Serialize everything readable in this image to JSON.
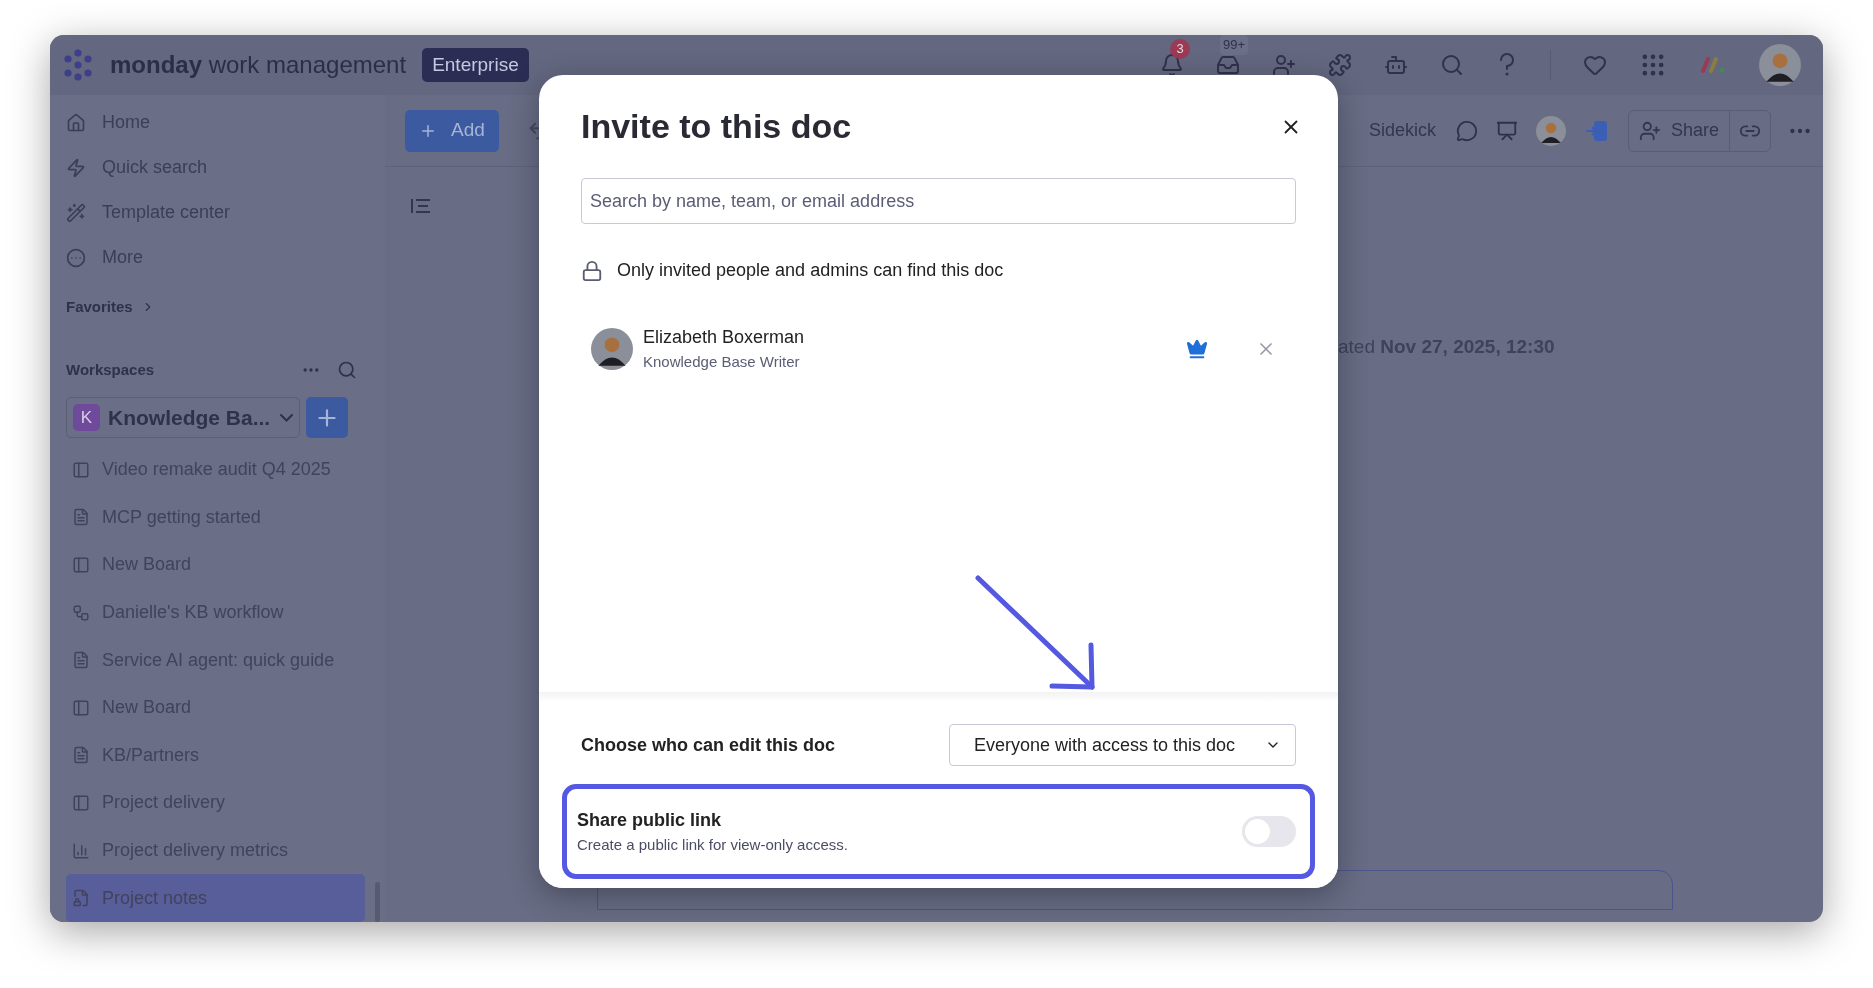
{
  "top_bar": {
    "brand_bold": "monday",
    "brand_rest": "work management",
    "plan_badge": "Enterprise",
    "notification_count": "3",
    "inbox_count": "99+"
  },
  "sidebar": {
    "nav": [
      {
        "label": "Home",
        "kind": "home"
      },
      {
        "label": "Quick search",
        "kind": "quick"
      },
      {
        "label": "Template center",
        "kind": "templates"
      },
      {
        "label": "More",
        "kind": "more"
      }
    ],
    "favorites": "Favorites",
    "workspaces": "Workspaces",
    "workspace": {
      "initial": "K",
      "name": "Knowledge Ba..."
    },
    "items": [
      {
        "label": "Video remake audit Q4 2025",
        "kind": "board",
        "selected": false
      },
      {
        "label": "MCP getting started",
        "kind": "doc",
        "selected": false
      },
      {
        "label": "New Board",
        "kind": "board",
        "selected": false
      },
      {
        "label": "Danielle's KB workflow",
        "kind": "workflow",
        "selected": false
      },
      {
        "label": "Service AI agent: quick guide",
        "kind": "doc",
        "selected": false
      },
      {
        "label": "New Board",
        "kind": "board",
        "selected": false
      },
      {
        "label": "KB/Partners",
        "kind": "doc",
        "selected": false
      },
      {
        "label": "Project delivery",
        "kind": "board",
        "selected": false
      },
      {
        "label": "Project delivery metrics",
        "kind": "dashboard",
        "selected": false
      },
      {
        "label": "Project notes",
        "kind": "doc_locked",
        "selected": true
      }
    ]
  },
  "doc_toolbar": {
    "add_button": "Add",
    "sidekick": "Sidekick",
    "share_button": "Share"
  },
  "doc": {
    "updated": "ated **Nov 27, 2025, 12:30**"
  },
  "dialog": {
    "title": "Invite to this doc",
    "search": {
      "placeholder": "Search by name, team, or email address"
    },
    "privacy_note": "Only invited people and admins can find this doc",
    "members": [
      {
        "name": "Elizabeth Boxerman",
        "role": "Knowledge Base Writer",
        "owner": true
      }
    ],
    "edit_permission": {
      "label": "Choose who can edit this doc",
      "value": "Everyone with access to this doc"
    },
    "public_link": {
      "title": "Share public link",
      "description": "Create a public link for view-only access.",
      "on": false
    }
  }
}
